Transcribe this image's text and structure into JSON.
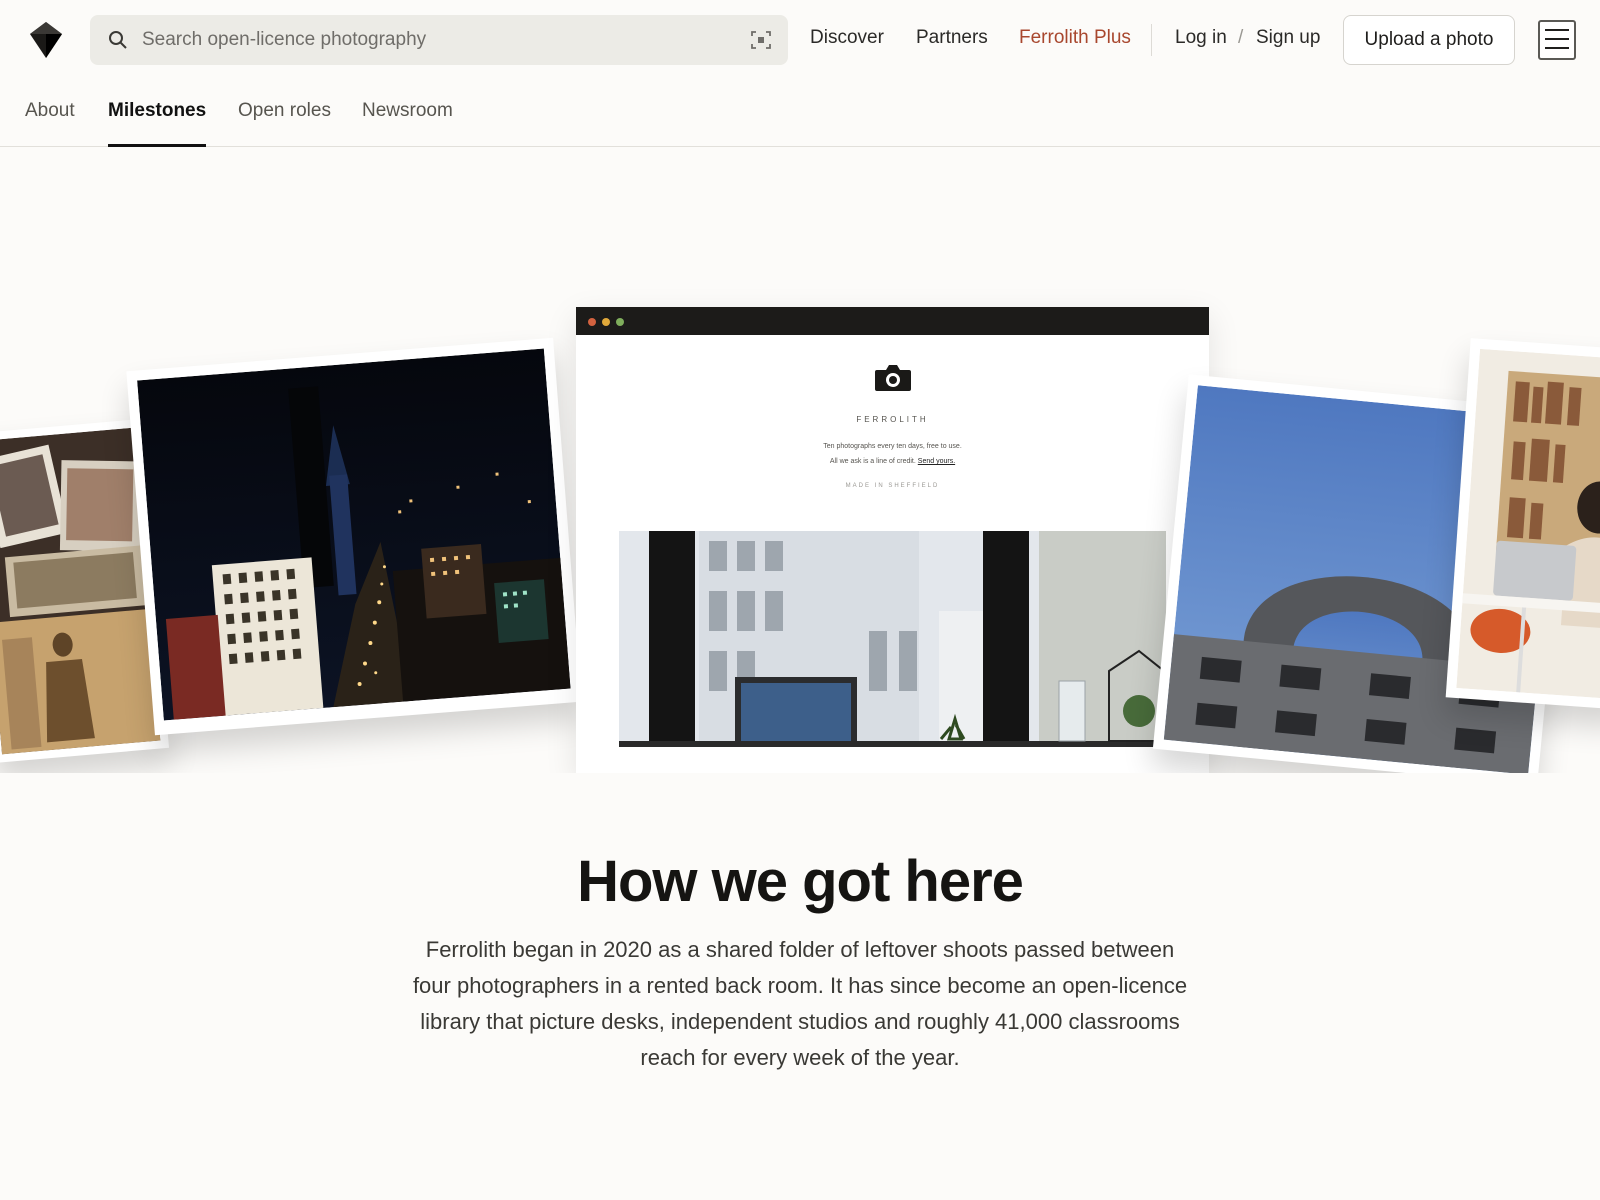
{
  "header": {
    "logo": "ferrolith-diamond-logo",
    "search_placeholder": "Search open-licence photography",
    "nav": {
      "discover": "Discover",
      "partners": "Partners",
      "plus": "Ferrolith Plus",
      "login": "Log in",
      "separator": "/",
      "signup": "Sign up"
    },
    "upload_label": "Upload a photo",
    "icons": {
      "search": "search-icon",
      "visual_search": "scan-icon",
      "menu": "hamburger-icon"
    }
  },
  "tabs": [
    {
      "label": "About",
      "active": false
    },
    {
      "label": "Milestones",
      "active": true
    },
    {
      "label": "Open roles",
      "active": false
    },
    {
      "label": "Newsroom",
      "active": false
    }
  ],
  "hero": {
    "mockup": {
      "brand": "FERROLITH",
      "line1": "Ten photographs every ten days, free to use.",
      "line2_prefix": "All we ask is a line of credit.",
      "line2_link": "Send yours.",
      "made_in": "MADE IN SHEFFIELD"
    }
  },
  "intro": {
    "title": "How we got here",
    "body": "Ferrolith began in 2020 as a shared folder of leftover shoots passed between four photographers in a rented back room. It has since become an open-licence library that picture desks, independent studios and roughly 41,000 classrooms reach for every week of the year."
  },
  "colors": {
    "background": "#fcfbf9",
    "accent_plus": "#a8472e",
    "search_bg": "#ecebe6"
  }
}
